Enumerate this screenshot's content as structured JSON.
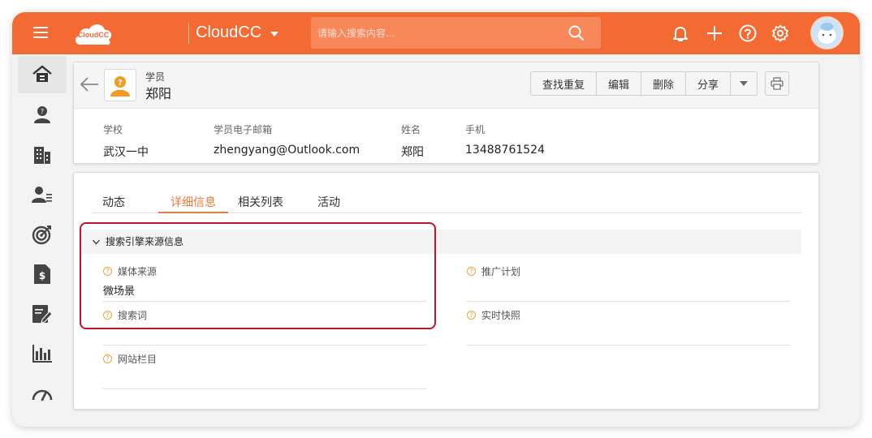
{
  "topbar": {
    "logo_text": "CloudCC",
    "app_name": "CloudCC",
    "search_placeholder": "请输入搜索内容...",
    "icons": [
      "menu-icon",
      "bell-icon",
      "plus-icon",
      "help-icon",
      "gear-icon",
      "avatar"
    ]
  },
  "sidebar": {
    "items": [
      "home-icon",
      "contact-icon",
      "building-icon",
      "user-list-icon",
      "target-icon",
      "dollar-doc-icon",
      "edit-doc-icon",
      "bar-chart-icon",
      "gauge-icon"
    ]
  },
  "record": {
    "type_label": "学员",
    "name": "郑阳",
    "buttons": [
      "查找重复",
      "编辑",
      "删除",
      "分享"
    ],
    "fields": [
      {
        "label": "学校",
        "value": "武汉一中"
      },
      {
        "label": "学员电子邮箱",
        "value": "zhengyang@Outlook.com"
      },
      {
        "label": "姓名",
        "value": "郑阳"
      },
      {
        "label": "手机",
        "value": "13488761524"
      }
    ]
  },
  "tabs": [
    "动态",
    "详细信息",
    "相关列表",
    "活动"
  ],
  "active_tab": "详细信息",
  "section": {
    "title": "搜索引擎来源信息",
    "fields": [
      {
        "label": "媒体来源",
        "value": "微场景"
      },
      {
        "label": "推广计划",
        "value": ""
      },
      {
        "label": "搜索词",
        "value": ""
      },
      {
        "label": "实时快照",
        "value": ""
      },
      {
        "label": "网站栏目",
        "value": ""
      }
    ]
  },
  "colors": {
    "brand": "#f46a33",
    "active_tab": "#f07a3c",
    "highlight_box": "#c0152a"
  }
}
